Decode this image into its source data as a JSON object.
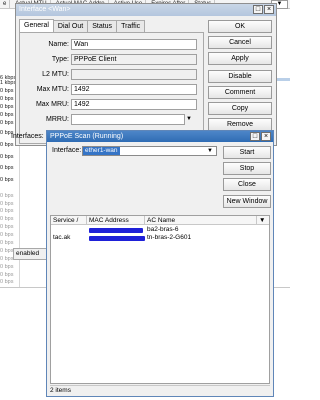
{
  "background": {
    "columns": [
      "e",
      "Actual MTU",
      "Actual MAC Addre",
      "Active Use",
      "Expires After",
      "Status"
    ],
    "filter_arrow": "▼",
    "rates": [
      {
        "text": "6 kbps",
        "gray": false
      },
      {
        "text": "1 kbps",
        "gray": false
      },
      {
        "text": "0 bps",
        "gray": false
      },
      {
        "text": "0 bps",
        "gray": false
      },
      {
        "text": "0 bps",
        "gray": false
      },
      {
        "text": "0 bps",
        "gray": false
      },
      {
        "text": "0 bps",
        "gray": false
      },
      {
        "text": "0 bps",
        "gray": false
      },
      {
        "text": "0 bps",
        "gray": false
      },
      {
        "text": "0 bps",
        "gray": false
      },
      {
        "text": "0 bps",
        "gray": false
      },
      {
        "text": "0 bps",
        "gray": false
      },
      {
        "text": "0 bps",
        "gray": true
      },
      {
        "text": "0 bps",
        "gray": true
      },
      {
        "text": "0 bps",
        "gray": true
      },
      {
        "text": "0 bps",
        "gray": true
      },
      {
        "text": "0 bps",
        "gray": true
      },
      {
        "text": "0 bps",
        "gray": true
      },
      {
        "text": "0 bps",
        "gray": true
      },
      {
        "text": "0 bps",
        "gray": true
      },
      {
        "text": "0 bps",
        "gray": true
      },
      {
        "text": "0 bps",
        "gray": true
      },
      {
        "text": "0 bps",
        "gray": true
      },
      {
        "text": "0 bps",
        "gray": true
      },
      {
        "text": "0 bps",
        "gray": false
      }
    ],
    "status": "enabled"
  },
  "iface_window": {
    "title": "Interface <Wan>",
    "tabs": [
      "General",
      "Dial Out",
      "Status",
      "Traffic"
    ],
    "fields": {
      "name_label": "Name:",
      "name_value": "Wan",
      "type_label": "Type:",
      "type_value": "PPPoE Client",
      "l2mtu_label": "L2 MTU:",
      "l2mtu_value": "",
      "maxmtu_label": "Max MTU:",
      "maxmtu_value": "1492",
      "maxmru_label": "Max MRU:",
      "maxmru_value": "1492",
      "mrru_label": "MRRU:",
      "mrru_value": "",
      "interfaces_label": "Interfaces:"
    },
    "buttons": [
      "OK",
      "Cancel",
      "Apply",
      "Disable",
      "Comment",
      "Copy",
      "Remove"
    ]
  },
  "scan_window": {
    "title": "PPPoE Scan (Running)",
    "interface_label": "Interface:",
    "interface_value": "ether1-wan",
    "buttons": {
      "start": "Start",
      "stop": "Stop",
      "close": "Close",
      "new_window": "New Window"
    },
    "columns": [
      "Service",
      "MAC Address",
      "AC Name"
    ],
    "rows": [
      {
        "service": "",
        "ac_name": "ba2-bras-6"
      },
      {
        "service": "tac.ak",
        "ac_name": "tn-bras-2-G601"
      }
    ],
    "item_count": "2 items"
  },
  "colors": {
    "accent": "#3574c6",
    "masked": "#1e20d8"
  }
}
